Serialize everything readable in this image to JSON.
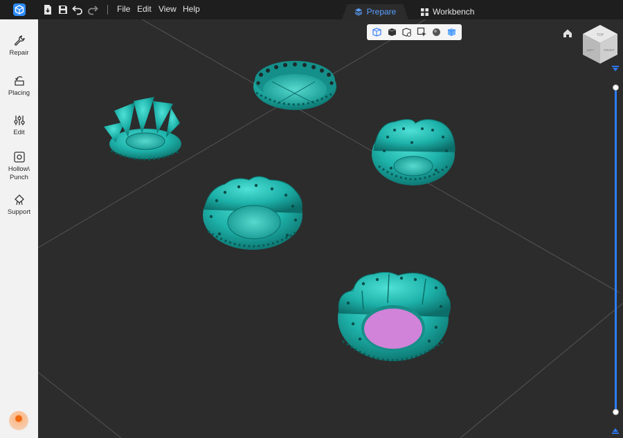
{
  "app": {
    "logo_icon": "app-logo-cube-icon"
  },
  "toolbar": {
    "icons": [
      "import-icon",
      "save-icon",
      "undo-icon",
      "redo-icon"
    ]
  },
  "menu": {
    "file": "File",
    "edit": "Edit",
    "view": "View",
    "help": "Help"
  },
  "tabs": {
    "prepare": "Prepare",
    "workbench": "Workbench",
    "active": "prepare"
  },
  "sidebar": {
    "items": [
      {
        "label": "Repair",
        "icon": "wrench-icon"
      },
      {
        "label": "Placing",
        "icon": "placing-icon"
      },
      {
        "label": "Edit",
        "icon": "sliders-icon"
      },
      {
        "label": "Hollow\\\nPunch",
        "icon": "hollow-punch-icon"
      },
      {
        "label": "Support",
        "icon": "support-icon"
      }
    ]
  },
  "view_toolbar": {
    "buttons": [
      "box-view-icon",
      "solid-view-icon",
      "wireframe-view-icon",
      "select-view-icon",
      "sphere-shading-icon",
      "transparent-view-icon"
    ],
    "active": "transparent-view-icon"
  },
  "nav_cube": {
    "top": "TOP",
    "left": "LEFT",
    "front": "FRONT"
  },
  "colors": {
    "accent": "#2f7dff",
    "model": "#1fb5ad",
    "selected_fill": "#d083d8",
    "background": "#2c2c2c"
  },
  "layer_slider": {
    "value": 1.0
  }
}
